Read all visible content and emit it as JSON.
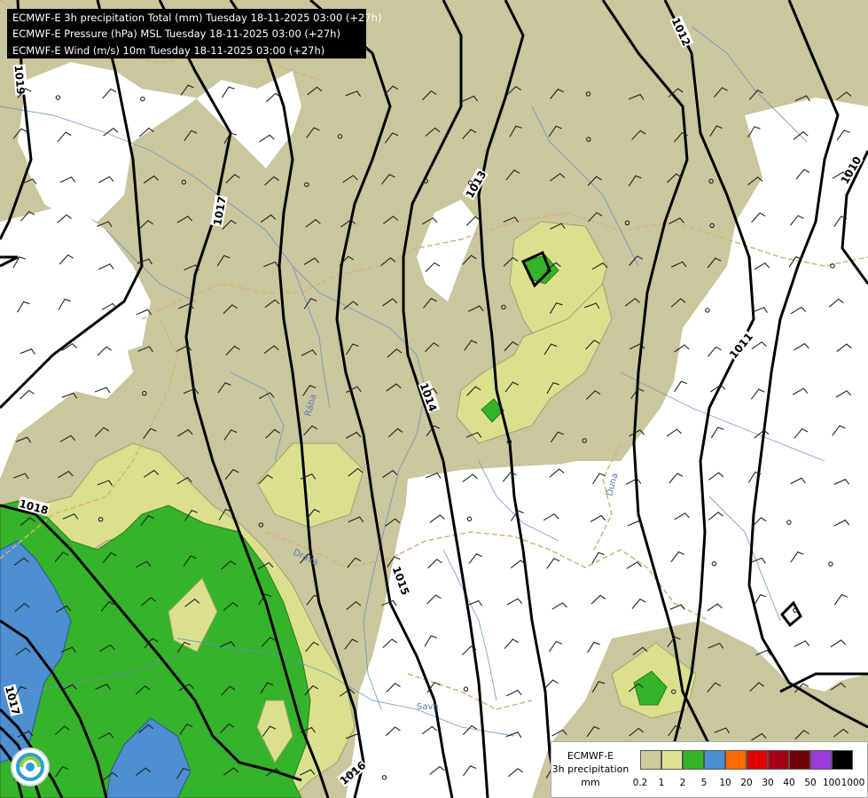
{
  "header": {
    "lines": [
      "ECMWF-E 3h precipitation Total (mm) Tuesday 18-11-2025 03:00 (+27h)",
      "ECMWF-E Pressure (hPa) MSL Tuesday 18-11-2025 03:00 (+27h)",
      "ECMWF-E Wind (m/s) 10m Tuesday 18-11-2025 03:00 (+27h)"
    ]
  },
  "isobars": [
    "1019",
    "1017",
    "1018",
    "1017",
    "1016",
    "1015",
    "1014",
    "1013",
    "1012",
    "1011",
    "1010"
  ],
  "rivers": [
    "Rába",
    "Duna",
    "Drava",
    "Sava"
  ],
  "legend": {
    "title_line1": "ECMWF-E",
    "title_line2": "3h precipitation",
    "unit": "mm",
    "ticks": [
      "0.2",
      "1",
      "2",
      "5",
      "10",
      "20",
      "30",
      "40",
      "50",
      "100",
      "1000"
    ],
    "colors": [
      "#cdcb9e",
      "#dfe296",
      "#33b526",
      "#4c8ed2",
      "#ff6a00",
      "#e00000",
      "#a30012",
      "#70000a",
      "#9a3ad8",
      "#000000"
    ]
  },
  "colors": {
    "precip_01": "#c8c49a",
    "precip_1": "#d9df92",
    "precip_2": "#35b32a",
    "precip_5": "#4d8fd1"
  },
  "logo": {
    "icon": "ecmwf-logo-icon"
  }
}
